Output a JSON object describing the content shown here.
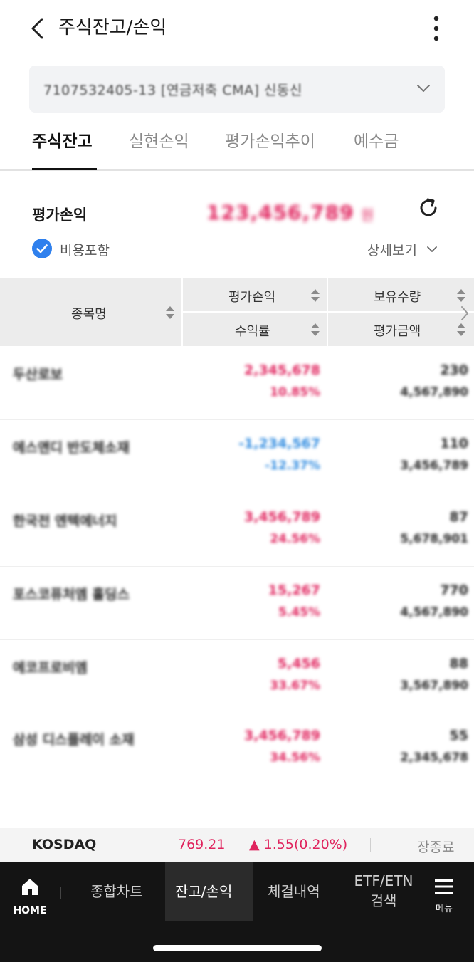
{
  "header": {
    "title": "주식잔고/손익"
  },
  "account": {
    "text": "7107532405-13 [연금저축 CMA] 신동신"
  },
  "tabs": [
    {
      "label": "주식잔고"
    },
    {
      "label": "실현손익"
    },
    {
      "label": "평가손익추이"
    },
    {
      "label": "예수금"
    }
  ],
  "summary": {
    "label": "평가손익",
    "value": "123,456,789",
    "unit": "원",
    "include_cost_label": "비용포함",
    "include_cost_checked": true,
    "detail_label": "상세보기"
  },
  "table": {
    "col_name": "종목명",
    "col_pl": "평가손익",
    "col_rate": "수익률",
    "col_qty": "보유수량",
    "col_amt": "평가금액",
    "rows": [
      {
        "name": "두산로보",
        "pl": "2,345,678",
        "rate": "10.85%",
        "qty": "230",
        "amt": "4,567,890",
        "direction": "up"
      },
      {
        "name": "에스앤디 반도체소재",
        "pl": "-1,234,567",
        "rate": "-12.37%",
        "qty": "110",
        "amt": "3,456,789",
        "direction": "down"
      },
      {
        "name": "한국전 엔텍에너지",
        "pl": "3,456,789",
        "rate": "24.56%",
        "qty": "87",
        "amt": "5,678,901",
        "direction": "up"
      },
      {
        "name": "포스코퓨처엠 홀딩스",
        "pl": "15,267",
        "rate": "5.45%",
        "qty": "770",
        "amt": "4,567,890",
        "direction": "up"
      },
      {
        "name": "에코프로비엠",
        "pl": "5,456",
        "rate": "33.67%",
        "qty": "88",
        "amt": "3,567,890",
        "direction": "up"
      },
      {
        "name": "삼성 디스플레이 소재",
        "pl": "3,456,789",
        "rate": "34.56%",
        "qty": "55",
        "amt": "2,345,678",
        "direction": "up"
      }
    ]
  },
  "ticker": {
    "name": "KOSDAQ",
    "price": "769.21",
    "change": "▲ 1.55(0.20%)",
    "status": "장종료"
  },
  "nav": {
    "home": "HOME",
    "items": [
      {
        "label": "종합차트"
      },
      {
        "label": "잔고/손익"
      },
      {
        "label": "체결내역"
      }
    ],
    "etf_line1": "ETF/ETN",
    "etf_line2": "검색",
    "menu": "메뉴"
  },
  "colors": {
    "up": "#e0245e",
    "down": "#2f8be0",
    "check": "#2f80ed",
    "nav_bg": "#141414"
  }
}
